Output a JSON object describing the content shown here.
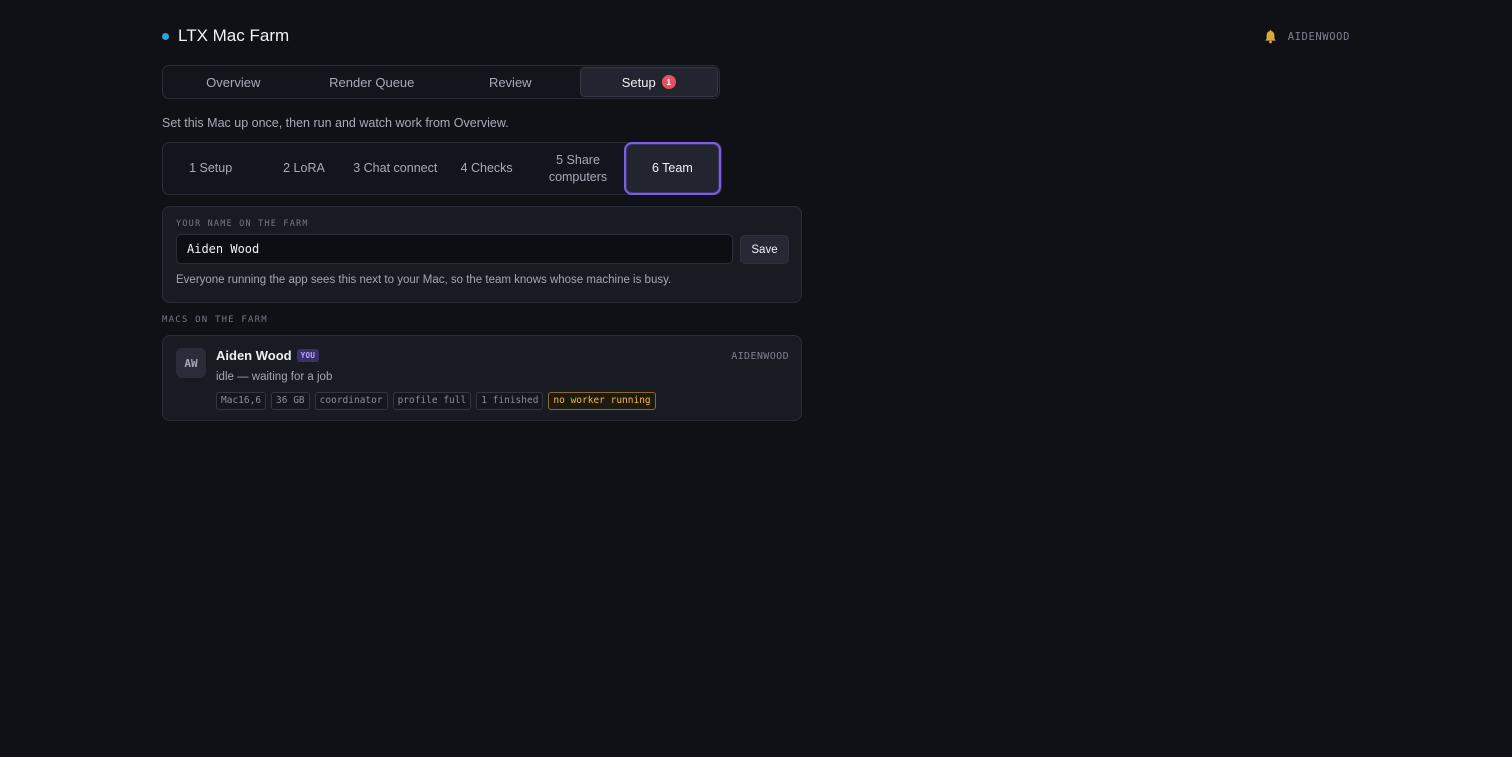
{
  "header": {
    "title": "LTX Mac Farm",
    "user_handle": "AIDENWOOD",
    "bell_icon": "bell-icon",
    "accent_color": "#2aa5d8"
  },
  "main_tabs": [
    {
      "label": "Overview",
      "active": false
    },
    {
      "label": "Render Queue",
      "active": false
    },
    {
      "label": "Review",
      "active": false
    },
    {
      "label": "Setup",
      "active": true,
      "badge": "1"
    }
  ],
  "intro_text": "Set this Mac up once, then run and watch work from Overview.",
  "step_tabs": [
    {
      "label": "1 Setup",
      "active": false
    },
    {
      "label": "2 LoRA",
      "active": false
    },
    {
      "label": "3 Chat connect",
      "active": false
    },
    {
      "label": "4 Checks",
      "active": false
    },
    {
      "label": "5 Share computers",
      "active": false
    },
    {
      "label": "6 Team",
      "active": true
    }
  ],
  "name_card": {
    "label": "YOUR NAME ON THE FARM",
    "input_value": "Aiden Wood",
    "save_label": "Save",
    "help": "Everyone running the app sees this next to your Mac, so the team knows whose machine is busy."
  },
  "macs_section": {
    "label": "MACS ON THE FARM",
    "macs": [
      {
        "initials": "AW",
        "name": "Aiden Wood",
        "you_badge": "YOU",
        "handle": "AIDENWOOD",
        "status": "idle — waiting for a job",
        "chips": [
          {
            "text": "Mac16,6",
            "warn": false
          },
          {
            "text": "36 GB",
            "warn": false
          },
          {
            "text": "coordinator",
            "warn": false
          },
          {
            "text": "profile full",
            "warn": false
          },
          {
            "text": "1 finished",
            "warn": false
          },
          {
            "text": "no worker running",
            "warn": true
          }
        ]
      }
    ]
  },
  "colors": {
    "background": "#101117",
    "active_step_border": "#7d5ee6",
    "badge": "#e3525f",
    "warning": "#f0b849"
  }
}
